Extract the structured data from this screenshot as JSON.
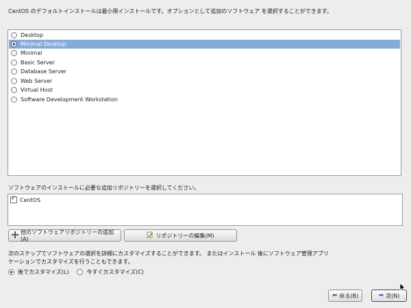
{
  "intro_text": "CentOS のデフォルトインストールは最小限インストールです。オプションとして追加のソフトウェア を選択することができます。",
  "install_options": [
    {
      "label": "Desktop",
      "selected": false
    },
    {
      "label": "Minimal Desktop",
      "selected": true
    },
    {
      "label": "Minimal",
      "selected": false
    },
    {
      "label": "Basic Server",
      "selected": false
    },
    {
      "label": "Database Server",
      "selected": false
    },
    {
      "label": "Web Server",
      "selected": false
    },
    {
      "label": "Virtual Host",
      "selected": false
    },
    {
      "label": "Software Development Workstation",
      "selected": false
    }
  ],
  "repo_prompt": "ソフトウェアのインストールに必要な追加リポジトリーを選択してください。",
  "repositories": [
    {
      "label": "CentOS",
      "checked": true
    }
  ],
  "buttons": {
    "add_repo": "他のソフトウェアリポジトリーの追加(A)",
    "edit_repo": "リポジトリーの編集(M)",
    "back": "戻る(B)",
    "next": "次(N)"
  },
  "customize_text": "次のステップでソフトウェアの選択を詳細にカスタマイズすることができます。 またはインストール 後にソフトウェア管理アプリケーションでカスタマイズを行うこともできます。",
  "customize_options": {
    "later": "後でカスタマイズ(L)",
    "now": "今すぐカスタマイズ(C)",
    "selected": "later"
  },
  "colors": {
    "selection": "#86abd9",
    "background": "#ededed"
  }
}
